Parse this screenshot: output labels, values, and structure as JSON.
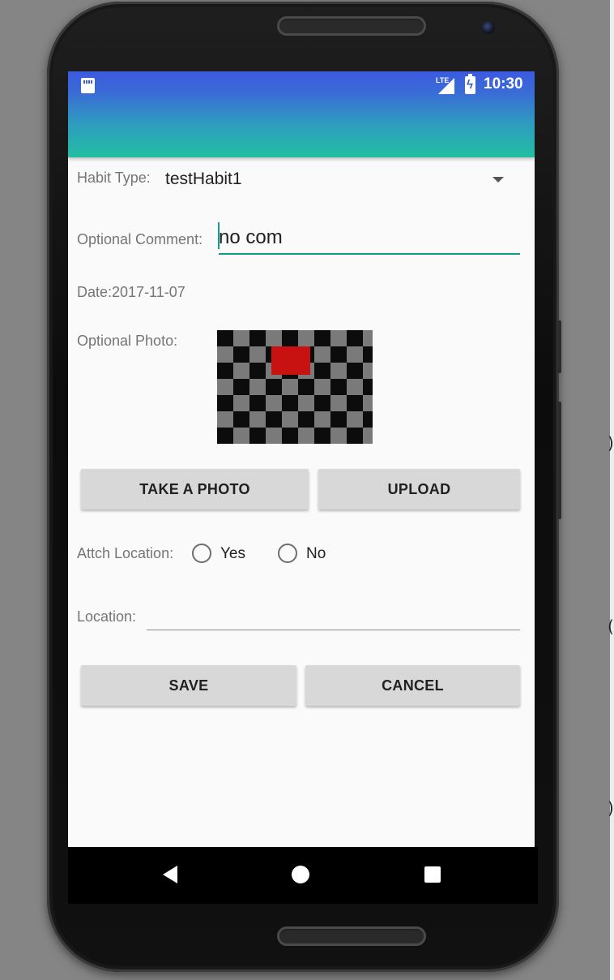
{
  "status_bar": {
    "time": "10:30",
    "icons": [
      "sd-card-icon",
      "lte-signal-icon",
      "battery-charging-icon"
    ],
    "network_label": "LTE"
  },
  "form": {
    "habit_type_label": "Habit Type:",
    "habit_type_value": "testHabit1",
    "comment_label": "Optional Comment:",
    "comment_value": "no com",
    "date_text": "Date:2017-11-07",
    "photo_label": "Optional Photo:",
    "take_photo_button": "TAKE A PHOTO",
    "upload_button": "UPLOAD",
    "attach_location_label": "Attch Location:",
    "radio_yes": "Yes",
    "radio_no": "No",
    "location_label": "Location:",
    "location_value": "",
    "save_button": "SAVE",
    "cancel_button": "CANCEL"
  },
  "colors": {
    "app_bar_top": "#3c5ae0",
    "app_bar_bottom": "#22bfa2",
    "accent": "#139c8b",
    "button_bg": "#d8d8d8",
    "photo_red": "#c81212"
  }
}
